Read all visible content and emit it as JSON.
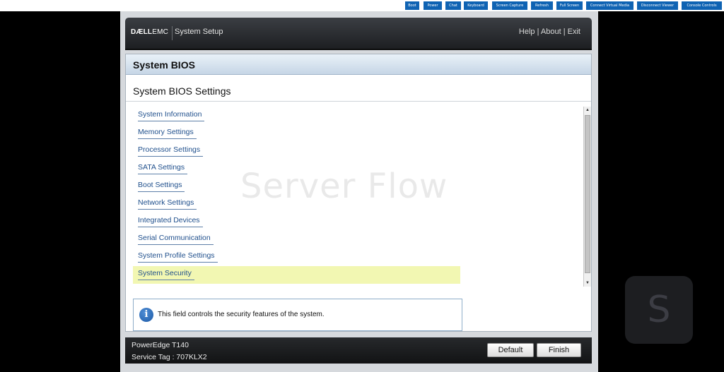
{
  "toolbar": {
    "buttons": [
      "Boot",
      "Power",
      "Chat",
      "Keyboard",
      "Screen Capture",
      "Refresh",
      "Full Screen",
      "Connect Virtual Media",
      "Disconnect Viewer",
      "Console Controls"
    ]
  },
  "header": {
    "logo_dell": "DÆLL",
    "logo_emc": "EMC",
    "title": "System Setup",
    "help": "Help",
    "about": "About",
    "exit": "Exit",
    "separator": " | "
  },
  "page": {
    "title": "System BIOS",
    "subtitle": "System BIOS Settings"
  },
  "menu": {
    "items": [
      {
        "label": "System Information"
      },
      {
        "label": "Memory Settings"
      },
      {
        "label": "Processor Settings"
      },
      {
        "label": "SATA Settings"
      },
      {
        "label": "Boot Settings"
      },
      {
        "label": "Network Settings"
      },
      {
        "label": "Integrated Devices"
      },
      {
        "label": "Serial Communication"
      },
      {
        "label": "System Profile Settings"
      },
      {
        "label": "System Security",
        "selected": true
      }
    ]
  },
  "help": {
    "text": "This field controls the security features of the system."
  },
  "footer": {
    "model": "PowerEdge T140",
    "service_tag": "Service Tag : 707KLX2",
    "default_label": "Default",
    "finish_label": "Finish"
  },
  "watermark": {
    "text": "Server Flow"
  },
  "badge": {
    "letter": "S"
  },
  "colors": {
    "toolbar_button": "#0f63b3",
    "link": "#1f4f8c",
    "selected_row": "#f2f7b2",
    "header_bg": "#2a2c30"
  }
}
